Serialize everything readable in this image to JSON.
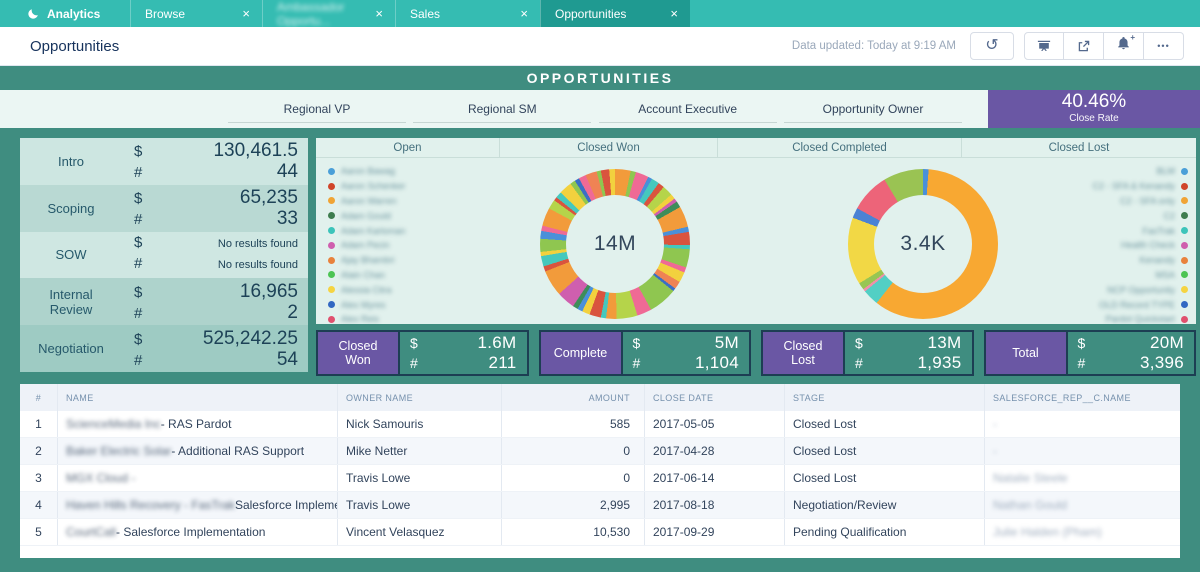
{
  "tabbar": {
    "brand_label": "Analytics",
    "close_glyph": "×",
    "tabs": [
      {
        "label": "Browse"
      },
      {
        "label": "Ambassador Opportu..."
      },
      {
        "label": "Sales"
      },
      {
        "label": "Opportunities"
      }
    ]
  },
  "header": {
    "title": "Opportunities",
    "data_updated": "Data updated: Today at 9:19 AM",
    "undo_glyph": "↺",
    "more_label": "•••",
    "bell_plus": "+"
  },
  "banner": {
    "title": "OPPORTUNITIES"
  },
  "filters": {
    "labels": [
      {
        "label": "Regional VP"
      },
      {
        "label": "Regional SM"
      },
      {
        "label": "Account Executive"
      },
      {
        "label": "Opportunity Owner"
      }
    ]
  },
  "close_rate": {
    "value": "40.46%",
    "label": "Close Rate"
  },
  "symbols": {
    "currency": "$",
    "count": "#"
  },
  "stage_metrics": {
    "rows": [
      {
        "stage": "Intro",
        "amount": "130,461.5",
        "count": "44",
        "bg": "#cde6e1",
        "size": "num"
      },
      {
        "stage": "Scoping",
        "amount": "65,235",
        "count": "33",
        "bg": "#b9d9d3",
        "size": "num"
      },
      {
        "stage": "SOW",
        "amount": "No results found",
        "count": "No results found",
        "bg": "#cfe7e2",
        "size": "empty"
      },
      {
        "stage": "Internal Review",
        "amount": "16,965",
        "count": "2",
        "bg": "#aed3cc",
        "size": "num"
      },
      {
        "stage": "Negotiation",
        "amount": "525,242.25",
        "count": "54",
        "bg": "#9ecbc3",
        "size": "num"
      }
    ]
  },
  "charts": {
    "column_headers": [
      {
        "label": "Open"
      },
      {
        "label": "Closed Won"
      },
      {
        "label": "Closed Completed"
      },
      {
        "label": "Closed Lost"
      }
    ],
    "left_legend": [
      {
        "name": "Aaron Bawag",
        "color": "#4a9fd8"
      },
      {
        "name": "Aaron Schenker",
        "color": "#d0452a"
      },
      {
        "name": "Aaron Warren",
        "color": "#f0a435"
      },
      {
        "name": "Adam Gould",
        "color": "#3e7d4f"
      },
      {
        "name": "Adam Karloman",
        "color": "#3cc4ba"
      },
      {
        "name": "Adam Pecin",
        "color": "#cf5fae"
      },
      {
        "name": "Ajay Bhambri",
        "color": "#e8823c"
      },
      {
        "name": "Alain Chan",
        "color": "#4cc454"
      },
      {
        "name": "Alessia Citra",
        "color": "#f5d442"
      },
      {
        "name": "Alex Myres",
        "color": "#3268c2"
      },
      {
        "name": "Alex Reis",
        "color": "#e0506e"
      }
    ],
    "right_legend": [
      {
        "name": "BLM",
        "color": "#4a9fd8"
      },
      {
        "name": "C2 - SFA & Kenandy",
        "color": "#d0452a"
      },
      {
        "name": "C2 - SFA only",
        "color": "#f0a435"
      },
      {
        "name": "C2",
        "color": "#3e7d4f"
      },
      {
        "name": "FasTrak",
        "color": "#3cc4ba"
      },
      {
        "name": "Health Check",
        "color": "#cf5fae"
      },
      {
        "name": "Kenandy",
        "color": "#e8823c"
      },
      {
        "name": "MSA",
        "color": "#4cc454"
      },
      {
        "name": "NCP Opportunity",
        "color": "#f5d442"
      },
      {
        "name": "OLD Record TYPE",
        "color": "#3268c2"
      },
      {
        "name": "Pardot Quickstart",
        "color": "#e0506e"
      }
    ]
  },
  "chart_data": [
    {
      "type": "donut",
      "title": "Closed Won",
      "center_label": "14M",
      "note": "many small segments, values approximate",
      "segments": [
        {
          "color": "#f29b3b",
          "value": 3
        },
        {
          "color": "#8fc650",
          "value": 1
        },
        {
          "color": "#ef6a95",
          "value": 2.5
        },
        {
          "color": "#4a90d9",
          "value": 0.8
        },
        {
          "color": "#45c8bd",
          "value": 1.5
        },
        {
          "color": "#d9543e",
          "value": 1.2
        },
        {
          "color": "#b5d44a",
          "value": 2
        },
        {
          "color": "#f2d13e",
          "value": 1
        },
        {
          "color": "#cf5fae",
          "value": 0.7
        },
        {
          "color": "#3e8d5a",
          "value": 1.2
        },
        {
          "color": "#f29b3b",
          "value": 4
        },
        {
          "color": "#4a90d9",
          "value": 1
        },
        {
          "color": "#d9543e",
          "value": 2.5
        },
        {
          "color": "#45c8bd",
          "value": 0.8
        },
        {
          "color": "#8fc650",
          "value": 3.5
        },
        {
          "color": "#ef6a95",
          "value": 1
        },
        {
          "color": "#f2d13e",
          "value": 2
        },
        {
          "color": "#ef8354",
          "value": 1.5
        },
        {
          "color": "#3a6fc4",
          "value": 0.6
        },
        {
          "color": "#8fc650",
          "value": 5.5
        },
        {
          "color": "#ef6a95",
          "value": 2.8
        },
        {
          "color": "#b5d44a",
          "value": 4
        },
        {
          "color": "#f29b3b",
          "value": 2
        },
        {
          "color": "#45c8bd",
          "value": 1
        },
        {
          "color": "#d9543e",
          "value": 2.2
        },
        {
          "color": "#f2d13e",
          "value": 1.5
        },
        {
          "color": "#4a90d9",
          "value": 1
        },
        {
          "color": "#3e8d5a",
          "value": 1
        },
        {
          "color": "#cf5fae",
          "value": 3.5
        },
        {
          "color": "#f29b3b",
          "value": 5
        },
        {
          "color": "#d9543e",
          "value": 1
        },
        {
          "color": "#45c8bd",
          "value": 2
        },
        {
          "color": "#f2d13e",
          "value": 0.8
        },
        {
          "color": "#8fc650",
          "value": 2.5
        },
        {
          "color": "#4a90d9",
          "value": 1.5
        },
        {
          "color": "#ef6a95",
          "value": 1
        },
        {
          "color": "#f29b3b",
          "value": 3.5
        },
        {
          "color": "#b5d44a",
          "value": 1.8
        },
        {
          "color": "#d9543e",
          "value": 0.7
        },
        {
          "color": "#45c8bd",
          "value": 1.2
        },
        {
          "color": "#f2d13e",
          "value": 2.5
        },
        {
          "color": "#8fc650",
          "value": 1
        },
        {
          "color": "#3a6fc4",
          "value": 0.9
        },
        {
          "color": "#ef6a95",
          "value": 1.4
        },
        {
          "color": "#ef8354",
          "value": 2.2
        },
        {
          "color": "#8fc650",
          "value": 0.8
        },
        {
          "color": "#d9543e",
          "value": 1.6
        },
        {
          "color": "#f2d13e",
          "value": 1.1
        }
      ]
    },
    {
      "type": "donut",
      "title": "Closed Completed",
      "center_label": "3.4K",
      "segments": [
        {
          "color": "#4a90d9",
          "value": 1.2
        },
        {
          "color": "#f8a832",
          "value": 59.4
        },
        {
          "color": "#52cfc4",
          "value": 3.5
        },
        {
          "color": "#f090a8",
          "value": 0.6
        },
        {
          "color": "#97c653",
          "value": 1.5
        },
        {
          "color": "#f2d845",
          "value": 14.5
        },
        {
          "color": "#4a82d4",
          "value": 2.2
        },
        {
          "color": "#ed6479",
          "value": 8.5
        },
        {
          "color": "#9ac353",
          "value": 8.6
        }
      ]
    }
  ],
  "kpis": [
    {
      "label": "Closed Won",
      "amount": "1.6M",
      "count": "211"
    },
    {
      "label": "Complete",
      "amount": "5M",
      "count": "1,104"
    },
    {
      "label": "Closed Lost",
      "amount": "13M",
      "count": "1,935"
    },
    {
      "label": "Total",
      "amount": "20M",
      "count": "3,396"
    }
  ],
  "table": {
    "columns": [
      "#",
      "NAME",
      "OWNER NAME",
      "AMOUNT",
      "CLOSE DATE",
      "STAGE",
      "SALESFORCE_REP__C.NAME"
    ],
    "rows": [
      {
        "num": "1",
        "name_blur": "ScienceMedia Inc",
        "name_rest": " - RAS Pardot",
        "owner": "Nick Samouris",
        "amount": "585",
        "close_date": "2017-05-05",
        "stage": "Closed Lost",
        "rep": "-"
      },
      {
        "num": "2",
        "name_blur": "Baker Electric Solar",
        "name_rest": " - Additional RAS Support",
        "owner": "Mike Netter",
        "amount": "0",
        "close_date": "2017-04-28",
        "stage": "Closed Lost",
        "rep": "-"
      },
      {
        "num": "3",
        "name_blur": "MGX Cloud -",
        "name_rest": "",
        "owner": "Travis Lowe",
        "amount": "0",
        "close_date": "2017-06-14",
        "stage": "Closed Lost",
        "rep": "Natalie Steele"
      },
      {
        "num": "4",
        "name_blur": "Haven Hills Recovery - FasTrak",
        "name_rest": " Salesforce Implementation",
        "owner": "Travis Lowe",
        "amount": "2,995",
        "close_date": "2017-08-18",
        "stage": "Negotiation/Review",
        "rep": "Nathan Gould"
      },
      {
        "num": "5",
        "name_blur": "CourtCall",
        "name_rest": " - Salesforce Implementation",
        "owner": "Vincent Velasquez",
        "amount": "10,530",
        "close_date": "2017-09-29",
        "stage": "Pending Qualification",
        "rep": "Julie Halden (Pham)"
      }
    ]
  }
}
